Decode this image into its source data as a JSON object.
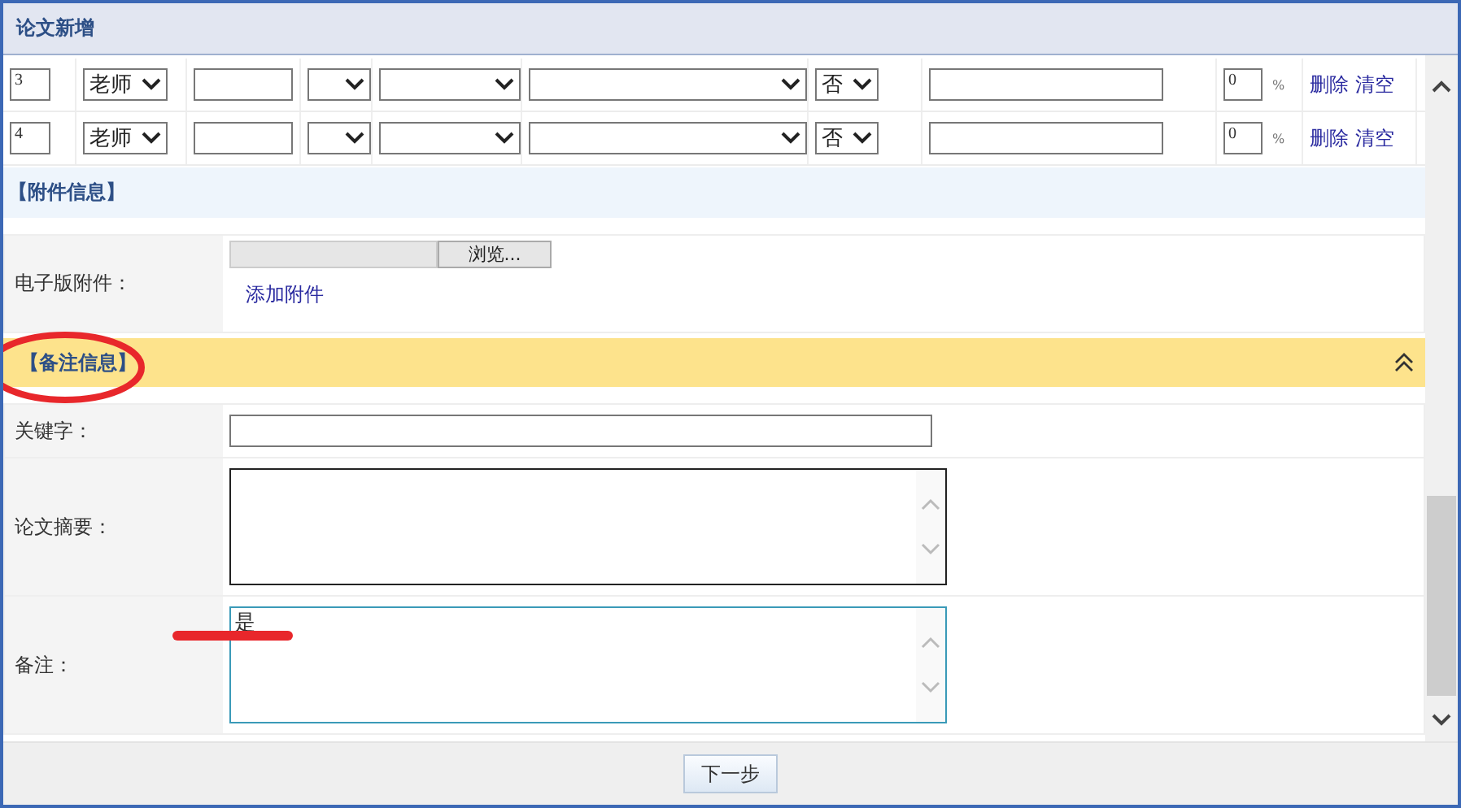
{
  "window": {
    "title": "论文新增"
  },
  "author_rows": [
    {
      "number": "3",
      "role": "老师",
      "yes_no": "否",
      "percent": "0",
      "percent_unit": "%",
      "actions": [
        "删除",
        "清空"
      ]
    },
    {
      "number": "4",
      "role": "老师",
      "yes_no": "否",
      "percent": "0",
      "percent_unit": "%",
      "actions": [
        "删除",
        "清空"
      ]
    }
  ],
  "attachment_section": {
    "title": "【附件信息】",
    "label": "电子版附件：",
    "browse_button": "浏览...",
    "add_link": "添加附件"
  },
  "remarks_section": {
    "title": "【备注信息】",
    "expanded": true,
    "fields": [
      {
        "kind": "input",
        "label": "关键字："
      },
      {
        "kind": "textarea",
        "label": "论文摘要："
      },
      {
        "kind": "textarea",
        "label": "备注：",
        "value": "是",
        "focused": true
      }
    ]
  },
  "footer": {
    "next_button": "下一步"
  }
}
